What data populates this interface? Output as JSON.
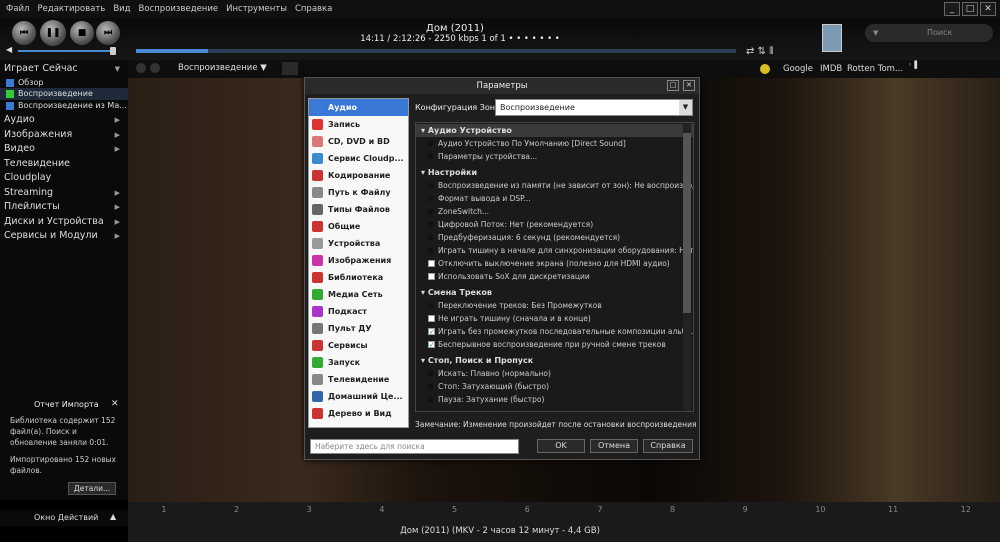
{
  "menu": [
    "Файл",
    "Редактировать",
    "Вид",
    "Воспроизведение",
    "Инструменты",
    "Справка"
  ],
  "player": {
    "title": "Дом (2011)",
    "info": "14:11 / 2:12:26 - 2250 kbps",
    "count": "1 of 1",
    "search_placeholder": "Поиск",
    "progress": 0.12
  },
  "sidebar": {
    "playing_now": "Играет Сейчас",
    "sub_items": [
      "Обзор",
      "Воспроизведение",
      "Воспроизведение из Ma..."
    ],
    "items": [
      "Аудио",
      "Изображения",
      "Видео",
      "Телевидение",
      "Cloudplay",
      "Streaming",
      "Плейлисты",
      "Диски и Устройства",
      "Сервисы и Модули"
    ],
    "import_title": "Отчет Импорта",
    "import_text1": "Библиотека содержит 152 файл(а). Поиск и обновление заняли 0:01.",
    "import_text2": "Импортировано 152 новых файлов.",
    "details_btn": "Детали...",
    "action_window": "Окно Действий"
  },
  "toolbar2": {
    "zone": "Воспроизведение",
    "links": [
      "Google",
      "IMDB",
      "Rotten Tom..."
    ]
  },
  "dialog": {
    "title": "Параметры",
    "zone_label": "Конфигурация Зоны:",
    "zone_value": "Воспроизведение",
    "categories": [
      {
        "label": "Аудио",
        "color": "#3a7bd5"
      },
      {
        "label": "Запись",
        "color": "#d33"
      },
      {
        "label": "CD, DVD и BD",
        "color": "#d77"
      },
      {
        "label": "Сервис Cloudp...",
        "color": "#3a8ad0"
      },
      {
        "label": "Кодирование",
        "color": "#c33"
      },
      {
        "label": "Путь к Файлу",
        "color": "#888"
      },
      {
        "label": "Типы Файлов",
        "color": "#666"
      },
      {
        "label": "Общие",
        "color": "#c33"
      },
      {
        "label": "Устройства",
        "color": "#999"
      },
      {
        "label": "Изображения",
        "color": "#c3a"
      },
      {
        "label": "Библиотека",
        "color": "#c33"
      },
      {
        "label": "Медиа Сеть",
        "color": "#3a3"
      },
      {
        "label": "Подкаст",
        "color": "#a3c"
      },
      {
        "label": "Пульт ДУ",
        "color": "#777"
      },
      {
        "label": "Сервисы",
        "color": "#c33"
      },
      {
        "label": "Запуск",
        "color": "#3a3"
      },
      {
        "label": "Телевидение",
        "color": "#888"
      },
      {
        "label": "Домашний Це...",
        "color": "#36a"
      },
      {
        "label": "Дерево и Вид",
        "color": "#c33"
      }
    ],
    "sections": [
      {
        "title": "Аудио Устройство",
        "options": [
          {
            "text": "Аудио Устройство По Умолчанию [Direct Sound]",
            "mark": "none"
          },
          {
            "text": "Параметры устройства...",
            "mark": "none"
          }
        ]
      },
      {
        "title": "Настройки",
        "options": [
          {
            "text": "Воспроизведение из памяти (не зависит от зон): Не воспроизвод...",
            "mark": "none"
          },
          {
            "text": "Формат вывода и DSP...",
            "mark": "none"
          },
          {
            "text": "ZoneSwitch...",
            "mark": "none"
          },
          {
            "text": "Цифровой Поток: Нет (рекомендуется)",
            "mark": "none"
          },
          {
            "text": "Предбуферизация: 6 секунд (рекомендуется)",
            "mark": "none"
          },
          {
            "text": "Играть тишину в начале для синхронизации оборудования: Нет",
            "mark": "none"
          },
          {
            "text": "Отключить выключение экрана (полезно для HDMI аудио)",
            "mark": "box"
          },
          {
            "text": "Использовать SoX для дискретизации",
            "mark": "box"
          }
        ]
      },
      {
        "title": "Смена Треков",
        "options": [
          {
            "text": "Переключение треков: Без Промежутков",
            "mark": "none"
          },
          {
            "text": "Не играть тишину (сначала и в конце)",
            "mark": "box"
          },
          {
            "text": "Играть без промежутков последовательные композиции альбо...",
            "mark": "check"
          },
          {
            "text": "Бесперывное воспроизведение при ручной смене треков",
            "mark": "check"
          }
        ]
      },
      {
        "title": "Стоп, Поиск и Пропуск",
        "options": [
          {
            "text": "Искать: Плавно (нормально)",
            "mark": "none"
          },
          {
            "text": "Стоп: Затухающий (быстро)",
            "mark": "none"
          },
          {
            "text": "Пауза: Затухание (быстро)",
            "mark": "none"
          }
        ]
      }
    ],
    "note": "Замечание: Изменение произойдет после остановки воспроизведения",
    "search_placeholder": "Наберите здесь для поиска",
    "ok": "OK",
    "cancel": "Отмена",
    "help": "Справка"
  },
  "chapters": [
    "1",
    "2",
    "3",
    "4",
    "5",
    "6",
    "7",
    "8",
    "9",
    "10",
    "11",
    "12"
  ],
  "file_info": "Дом (2011) (MKV - 2 часов 12 минут - 4,4 GB)"
}
